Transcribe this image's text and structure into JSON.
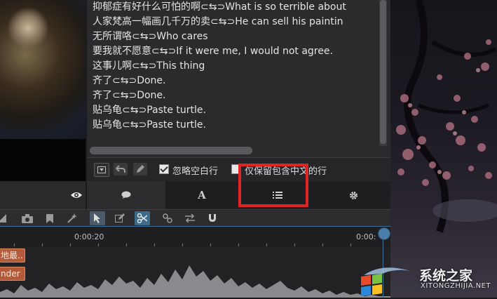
{
  "subtitles": {
    "lines": [
      "抑郁症有好什么可怕的啊⊂⇆⊃What is so terrible about",
      "人家梵高一幅画几千万的卖⊂⇆⊃He can sell his paintin",
      "无所谓咯⊂⇆⊃Who cares",
      "要我就不愿意⊂⇆⊃If it were me, I would not agree.",
      "这事儿啊⊂⇆⊃This thing",
      "齐了⊂⇆⊃Done.",
      "齐了⊂⇆⊃Done.",
      "贴乌龟⊂⇆⊃Paste turtle.",
      "贴乌龟⊂⇆⊃Paste turtle."
    ]
  },
  "options": {
    "ignore_blank_lines_label": "忽略空白行",
    "ignore_blank_lines_checked": true,
    "keep_only_label": "仅保留包含中文的行",
    "keep_only_checked": false
  },
  "tabs": [
    {
      "name": "comments",
      "icon": "speech-bubble-icon"
    },
    {
      "name": "text",
      "label": "A",
      "icon": "font-icon"
    },
    {
      "name": "list",
      "icon": "list-icon",
      "highlighted": true
    },
    {
      "name": "settings",
      "icon": "gear-icon"
    }
  ],
  "timeline": {
    "time_marker_1": "0:00:20",
    "time_marker_2": "0:00:",
    "clip_1": "地最..",
    "clip_2": "nder"
  },
  "watermark": {
    "text": "系统之家",
    "url": "XITONGZHIJIA.NET"
  },
  "colors": {
    "highlight": "#e02424",
    "clip": "#b25a3a",
    "accent": "#3f6e96"
  }
}
